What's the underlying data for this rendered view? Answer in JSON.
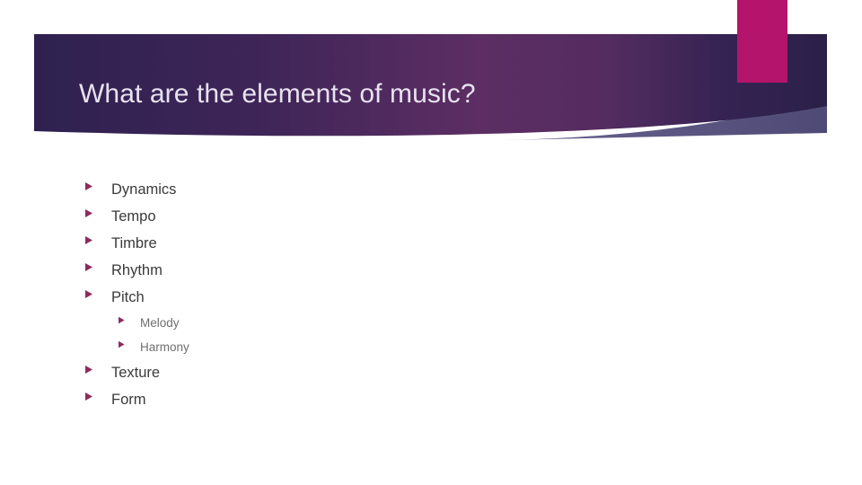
{
  "slide": {
    "title": "What are the elements of music?",
    "background_color": "#ffffff",
    "theme": {
      "banner_dark": "#2e2150",
      "banner_mid": "#5c2e63",
      "banner_edge": "#2b2048",
      "accent_pink": "#b4146b",
      "wedge_slate": "#56527d",
      "title_color": "#e8e2f0",
      "bullet_marker_color": "#8e2a5e",
      "body_text_color": "#3a3a3a",
      "sub_text_color": "#6f6f6f"
    },
    "decorations": {
      "accent_bar_name": "pink-accent-bar",
      "banner_name": "title-banner-shape",
      "wedge_name": "banner-highlight-wedge"
    },
    "bullets": [
      {
        "label": "Dynamics",
        "level": 1
      },
      {
        "label": "Tempo",
        "level": 1
      },
      {
        "label": "Timbre",
        "level": 1
      },
      {
        "label": "Rhythm",
        "level": 1
      },
      {
        "label": "Pitch",
        "level": 1
      },
      {
        "label": "Melody",
        "level": 2
      },
      {
        "label": "Harmony",
        "level": 2
      },
      {
        "label": "Texture",
        "level": 1
      },
      {
        "label": "Form",
        "level": 1
      }
    ]
  }
}
